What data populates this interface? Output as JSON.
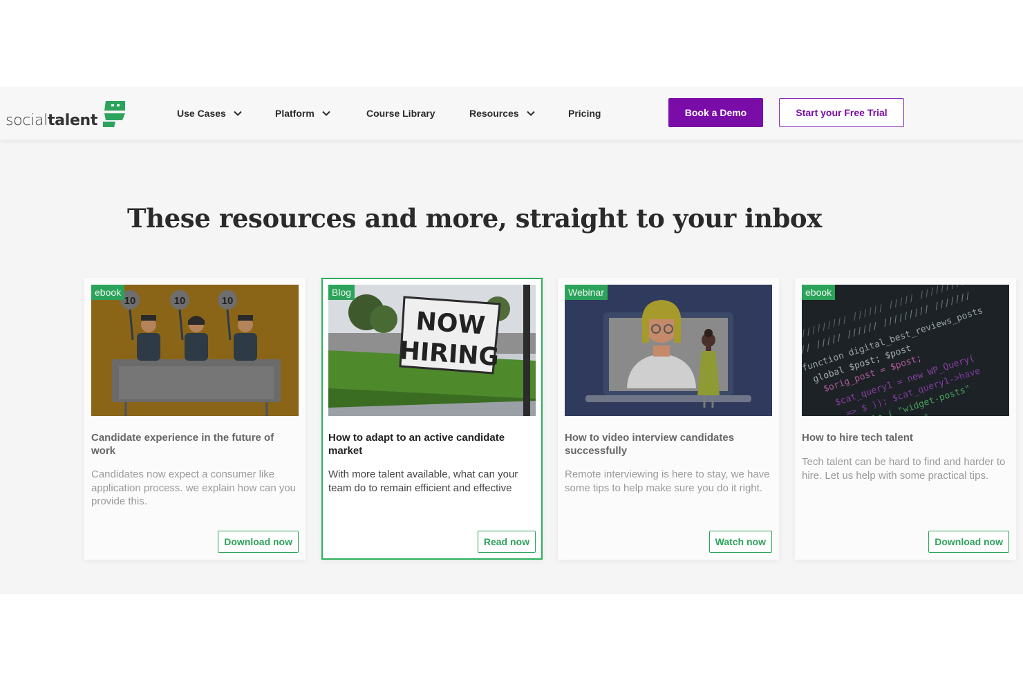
{
  "brand": {
    "name_light": "social",
    "name_bold": "talent",
    "green": "#2ca35a",
    "purple": "#7a0ca8"
  },
  "nav": {
    "items": [
      {
        "label": "Use Cases",
        "has_dropdown": true
      },
      {
        "label": "Platform",
        "has_dropdown": true
      },
      {
        "label": "Course Library",
        "has_dropdown": false
      },
      {
        "label": "Resources",
        "has_dropdown": true
      },
      {
        "label": "Pricing",
        "has_dropdown": false
      }
    ],
    "book_demo": "Book a Demo",
    "free_trial": "Start your Free Trial"
  },
  "section": {
    "title": "These resources and more, straight to your inbox"
  },
  "cards": [
    {
      "badge": "ebook",
      "title": "Candidate experience in the future of work",
      "desc": "Candidates now expect a consumer like application process. we explain how can you provide this.",
      "button": "Download now",
      "image": "judges-holding-score-cards-illustration"
    },
    {
      "badge": "Blog",
      "title": "How to adapt to an active candidate market",
      "desc": "With more talent available, what can your team do to remain efficient and effective",
      "button": "Read now",
      "image": "now-hiring-sign-photo",
      "sign_line1": "NOW",
      "sign_line2": "HIRING"
    },
    {
      "badge": "Webinar",
      "title": "How to video interview candidates successfully",
      "desc": "Remote interviewing is here to stay, we have some tips to help make sure you do it right.",
      "button": "Watch now",
      "image": "video-interview-laptop-illustration"
    },
    {
      "badge": "ebook",
      "title": "How to hire tech talent",
      "desc": "Tech talent can be hard to find and harder to hire. Let us help with some practical tips.",
      "button": "Download now",
      "image": "code-on-screen-photo"
    }
  ]
}
